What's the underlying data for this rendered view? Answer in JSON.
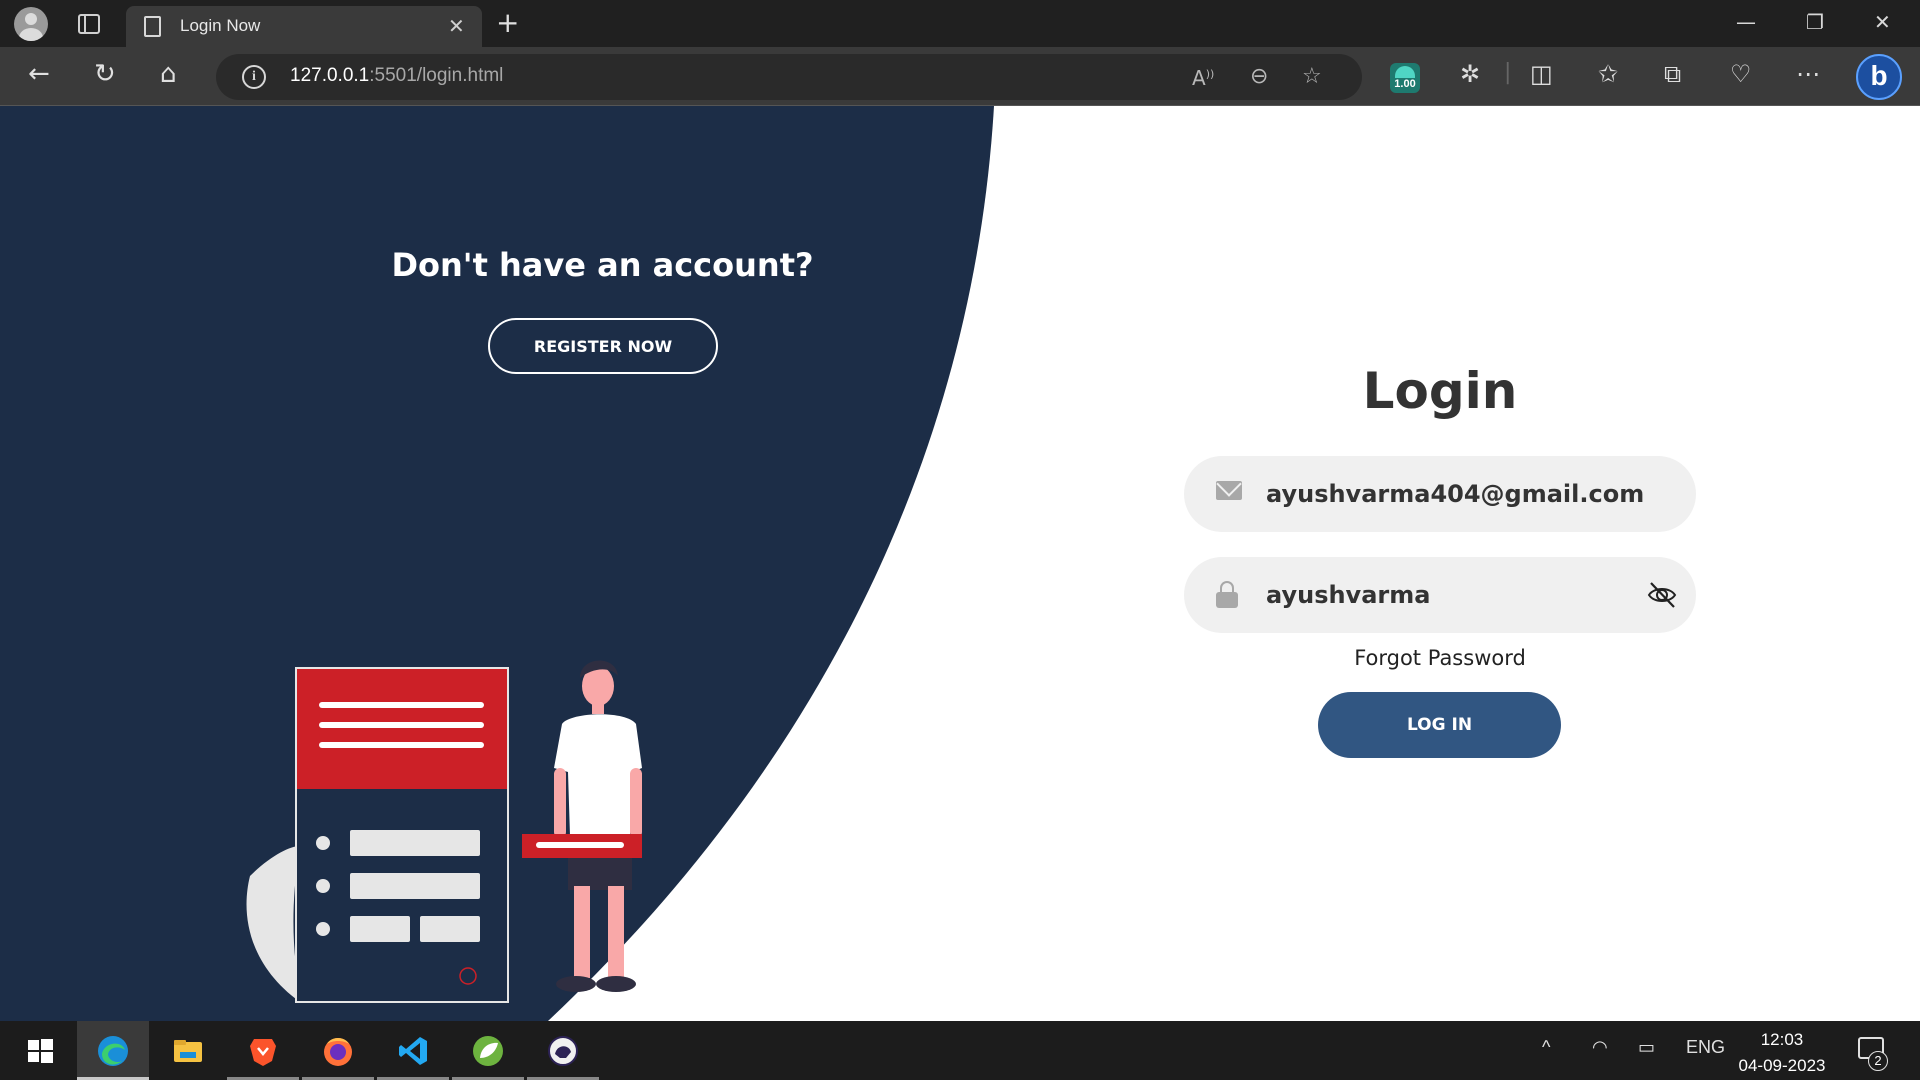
{
  "browser": {
    "tab_title": "Login Now",
    "tab_close": "✕",
    "new_tab": "+",
    "url_host": "127.0.0.1",
    "url_path": ":5501/login.html",
    "extension_badge": "1.00",
    "bing_label": "b",
    "window_controls": {
      "minimize": "—",
      "restore": "❐",
      "close": "✕"
    },
    "nav": {
      "back": "←",
      "refresh": "↻",
      "home": "⌂"
    },
    "toolbar_icons": [
      "read-aloud-icon",
      "zoom-out-icon",
      "favorite-star-icon",
      "extension-badge-icon",
      "extensions-puzzle-icon",
      "split-screen-icon",
      "favorites-icon",
      "collections-icon",
      "browser-essentials-icon",
      "more-icon",
      "bing-copilot-icon"
    ]
  },
  "page": {
    "left": {
      "heading": "Don't have an account?",
      "register_label": "REGISTER NOW",
      "panel_color": "#1c2d47",
      "accent_red": "#cc2027"
    },
    "login": {
      "title": "Login",
      "email_value": "ayushvarma404@gmail.com",
      "password_value": "ayushvarma",
      "forgot_label": "Forgot Password",
      "login_label": "LOG IN",
      "button_color": "#315682"
    }
  },
  "taskbar": {
    "apps": [
      "windows-start-icon",
      "edge-icon",
      "file-explorer-icon",
      "brave-icon",
      "firefox-icon",
      "vscode-icon",
      "spring-tools-icon",
      "eclipse-icon"
    ],
    "tray": {
      "chevron": "^",
      "language": "ENG"
    },
    "clock": {
      "time": "12:03",
      "date": "04-09-2023"
    },
    "notification_count": "2"
  }
}
